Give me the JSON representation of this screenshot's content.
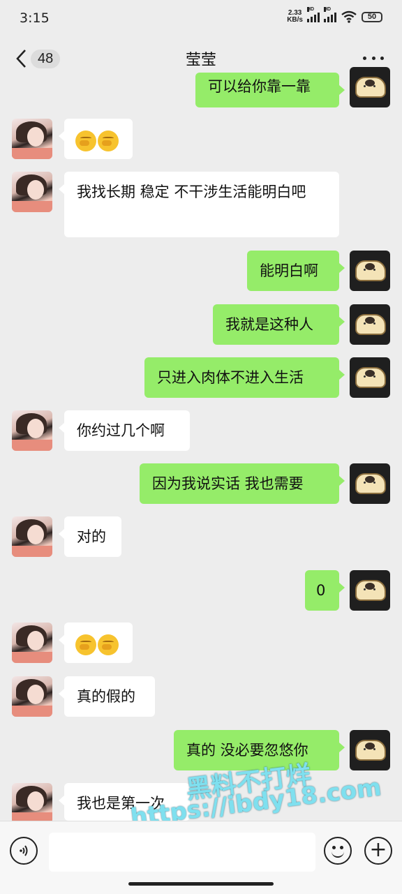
{
  "status_bar": {
    "time": "3:15",
    "net_speed_value": "2.33",
    "net_speed_unit": "KB/s",
    "signal_label": "HD",
    "battery": "50"
  },
  "nav": {
    "back_count": "48",
    "title": "莹莹",
    "more_icon": "more-dots-icon"
  },
  "messages": [
    {
      "side": "out",
      "text": "可以给你靠一靠"
    },
    {
      "side": "in",
      "text": "",
      "emoji": [
        "hand-over-mouth-emoji",
        "hand-over-mouth-emoji"
      ]
    },
    {
      "side": "in",
      "text": "我找长期 稳定 不干涉生活能明白吧"
    },
    {
      "side": "out",
      "text": "能明白啊"
    },
    {
      "side": "out",
      "text": "我就是这种人"
    },
    {
      "side": "out",
      "text": "只进入肉体不进入生活"
    },
    {
      "side": "in",
      "text": "你约过几个啊"
    },
    {
      "side": "out",
      "text": "因为我说实话 我也需要"
    },
    {
      "side": "in",
      "text": "对的"
    },
    {
      "side": "out",
      "text": "0"
    },
    {
      "side": "in",
      "text": "",
      "emoji": [
        "hand-over-mouth-emoji",
        "hand-over-mouth-emoji"
      ]
    },
    {
      "side": "in",
      "text": "真的假的"
    },
    {
      "side": "out",
      "text": "真的 没必要忽悠你"
    },
    {
      "side": "in",
      "text": "我也是第一次"
    }
  ],
  "watermark": {
    "line1": "黑料不打烊",
    "line2": "https://ibdy18.com"
  },
  "input_bar": {
    "voice_icon": "voice-icon",
    "emoji_icon": "emoji-icon",
    "plus_icon": "plus-icon",
    "plus_glyph": "+"
  }
}
